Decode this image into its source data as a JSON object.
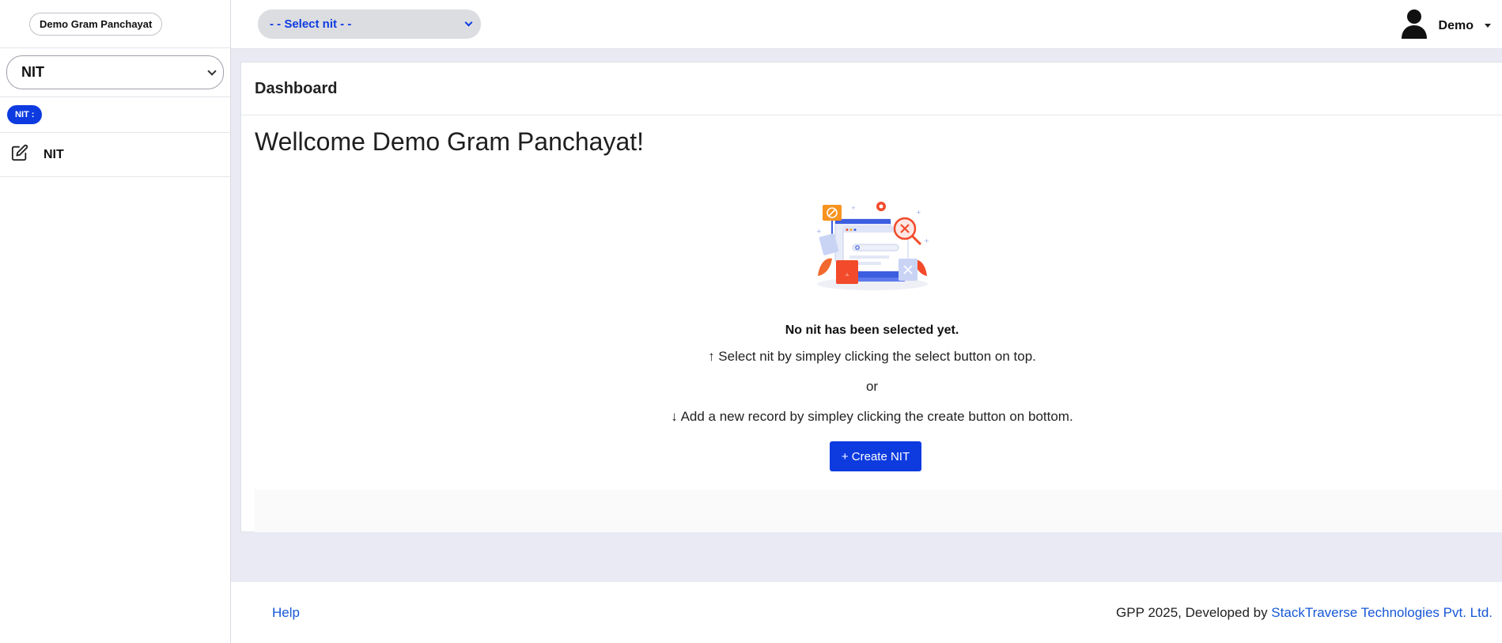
{
  "sidebar": {
    "brand": "Demo Gram Panchayat",
    "module_select": "NIT",
    "badge": "NIT :",
    "nav_items": [
      {
        "label": "NIT",
        "icon": "edit-icon"
      }
    ]
  },
  "topbar": {
    "nit_select_value": "- - Select nit - -",
    "user_name": "Demo",
    "user_icon": "user-icon"
  },
  "main": {
    "card_title": "Dashboard",
    "welcome": "Wellcome Demo Gram Panchayat!",
    "empty_title": "No nit has been selected yet.",
    "instruction_up": "↑ Select nit by simpley clicking the select button on top.",
    "or_text": "or",
    "instruction_down": "↓ Add a new record by simpley clicking the create button on bottom.",
    "create_button": "+ Create NIT"
  },
  "footer": {
    "help": "Help",
    "credit_prefix": "GPP 2025, Developed by ",
    "credit_link": "StackTraverse Technologies Pvt. Ltd."
  },
  "colors": {
    "accent": "#0d3be0",
    "link": "#1657d6",
    "background": "#e9eaf3"
  }
}
